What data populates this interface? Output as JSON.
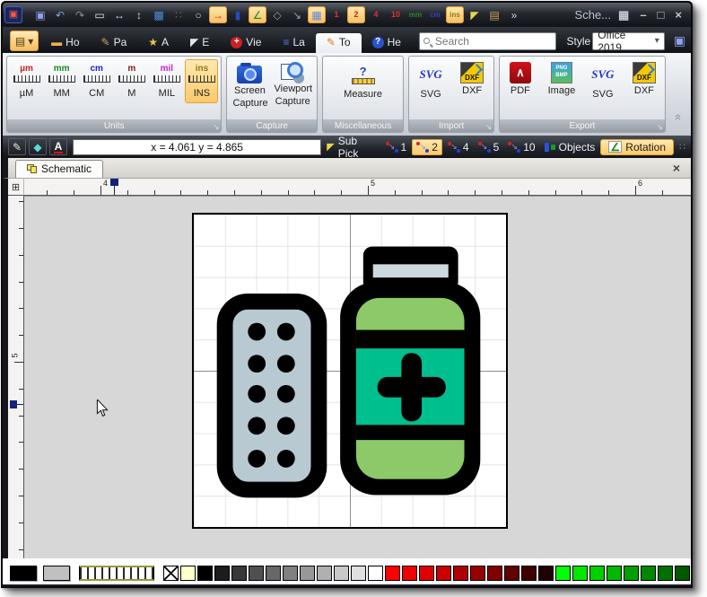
{
  "window": {
    "title": "Sche...",
    "controls": [
      {
        "name": "layout",
        "glyph": "▦"
      },
      {
        "name": "minimize",
        "glyph": "–"
      },
      {
        "name": "maximize",
        "glyph": "□"
      },
      {
        "name": "close",
        "glyph": "×"
      }
    ]
  },
  "titlebar": {
    "qat": [
      {
        "name": "app",
        "glyph": "▣",
        "color": "#ff5544",
        "hl": false
      },
      {
        "name": "save",
        "glyph": "▣",
        "color": "#8fa0ee",
        "hl": false
      },
      {
        "name": "undo",
        "glyph": "↶",
        "color": "#7aa0e0",
        "hl": false
      },
      {
        "name": "redo",
        "glyph": "↷",
        "color": "#8a9098",
        "hl": false
      },
      {
        "name": "rectangle",
        "glyph": "▭",
        "color": "#e8ecf2",
        "hl": false
      },
      {
        "name": "resize-width",
        "glyph": "↔",
        "color": "#cfd6e0",
        "hl": false
      },
      {
        "name": "resize-height",
        "glyph": "↕",
        "color": "#cfd6e0",
        "hl": false
      },
      {
        "name": "image",
        "glyph": "▩",
        "color": "#4a90d9",
        "hl": false
      },
      {
        "name": "pick-color",
        "glyph": "∷",
        "color": "#3a8a3a",
        "hl": false
      },
      {
        "name": "zoom",
        "glyph": "○",
        "color": "#d0d4da",
        "hl": false
      },
      {
        "name": "snap-point",
        "glyph": "→",
        "color": "#cc2222",
        "hl": true
      },
      {
        "name": "guides",
        "glyph": "▮",
        "color": "#2848c8",
        "hl": false
      },
      {
        "name": "chart",
        "glyph": "∠",
        "color": "#1a8a1a",
        "hl": true
      },
      {
        "name": "center-point",
        "glyph": "◇",
        "color": "#9aa0a8",
        "hl": false
      },
      {
        "name": "route",
        "glyph": "↘",
        "color": "#9aa0a8",
        "hl": false
      },
      {
        "name": "grid",
        "glyph": "▦",
        "color": "#6688dd",
        "hl": true
      },
      {
        "name": "snap-1",
        "glyph": "1",
        "color": "#dd3333",
        "hl": false
      },
      {
        "name": "snap-2",
        "glyph": "2",
        "color": "#cc2222",
        "hl": true
      },
      {
        "name": "snap-4",
        "glyph": "4",
        "color": "#dd3333",
        "hl": false
      },
      {
        "name": "snap-10",
        "glyph": "10",
        "color": "#dd3333",
        "hl": false
      },
      {
        "name": "unit-mm",
        "glyph": "mm",
        "color": "#2a8a2a",
        "hl": false
      },
      {
        "name": "unit-cm",
        "glyph": "cm",
        "color": "#3a3acc",
        "hl": false
      },
      {
        "name": "unit-ins",
        "glyph": "ins",
        "color": "#8a7a1a",
        "hl": true
      },
      {
        "name": "pointer",
        "glyph": "◤",
        "color": "#e8d44a",
        "hl": false
      },
      {
        "name": "properties",
        "glyph": "▤",
        "color": "#d0a858",
        "hl": false
      },
      {
        "name": "overflow",
        "glyph": "»",
        "color": "#cfd6e0",
        "hl": false
      }
    ]
  },
  "ribbon": {
    "menu": {
      "glyph": "▤",
      "caret": "▾"
    },
    "tabs": [
      {
        "id": "home",
        "label": "Ho",
        "glyph": "▬",
        "color": "#e8b64a"
      },
      {
        "id": "page",
        "label": "Pa",
        "glyph": "✎",
        "color": "#c8a060"
      },
      {
        "id": "arrange",
        "label": "A",
        "glyph": "★",
        "color": "#e8c84a"
      },
      {
        "id": "edit",
        "label": "E",
        "glyph": "◤",
        "color": "#e6e6ee"
      },
      {
        "id": "view",
        "label": "Vie",
        "glyph": "+",
        "color": "#ffffff",
        "bg": "#cc2222"
      },
      {
        "id": "layers",
        "label": "La",
        "glyph": "≡",
        "color": "#5a78e8"
      },
      {
        "id": "tools",
        "label": "To",
        "glyph": "✎",
        "color": "#e07820",
        "sel": true
      },
      {
        "id": "help",
        "label": "He",
        "glyph": "?",
        "color": "#ffffff",
        "bg": "#2a52cc"
      }
    ],
    "search": {
      "placeholder": "Search"
    },
    "style": {
      "label": "Style",
      "value": "Office 2019",
      "caret": "▾"
    },
    "save_glyph": "▣",
    "collapse_glyph": "«",
    "groups": {
      "launcher_glyph": "↘",
      "units": {
        "label": "Units",
        "buttons": [
          {
            "top": "µm",
            "color": "#cc2222",
            "caption": "µM"
          },
          {
            "top": "mm",
            "color": "#1a8a1a",
            "caption": "MM"
          },
          {
            "top": "cm",
            "color": "#2222cc",
            "caption": "CM"
          },
          {
            "top": "m",
            "color": "#8a1a1a",
            "caption": "M"
          },
          {
            "top": "mil",
            "color": "#cc22cc",
            "caption": "MIL"
          },
          {
            "top": "ins",
            "color": "#8a7a1a",
            "caption": "INS",
            "sel": true
          }
        ]
      },
      "capture": {
        "label": "Capture",
        "buttons": [
          {
            "label": "Screen\nCapture"
          },
          {
            "label": "Viewport\nCapture"
          }
        ]
      },
      "misc": {
        "label": "Miscellaneous",
        "buttons": [
          {
            "label": "Measure",
            "icon": "?"
          }
        ]
      },
      "import": {
        "label": "Import",
        "buttons": [
          {
            "label": "SVG",
            "icon": "SVG"
          },
          {
            "label": "DXF",
            "icon": "DXF"
          }
        ]
      },
      "export": {
        "label": "Export",
        "buttons": [
          {
            "label": "PDF",
            "icon": "∧"
          },
          {
            "label": "Image",
            "icon": "PNG\nBMP"
          },
          {
            "label": "SVG",
            "icon": "SVG"
          },
          {
            "label": "DXF",
            "icon": "DXF"
          }
        ]
      }
    }
  },
  "format_bar": {
    "tools": [
      {
        "name": "pen",
        "glyph": "✎",
        "color": "#e8e4d8"
      },
      {
        "name": "fill",
        "glyph": "◆",
        "color": "#5ad8d8"
      },
      {
        "name": "font-color",
        "glyph": "A",
        "color": "#ffffff",
        "underline": true
      }
    ],
    "coords": "x = 4.061 y = 4.865",
    "sub_pick_glyph": "◤",
    "sub_pick": "Sub Pick",
    "snap_glyph": "↘",
    "snaps": [
      {
        "label": "1"
      },
      {
        "label": "2",
        "sel": true
      },
      {
        "label": "4"
      },
      {
        "label": "5"
      },
      {
        "label": "10"
      }
    ],
    "objects": "Objects",
    "rotation_glyph": "∠",
    "rotation": "Rotation",
    "grip_glyph": "∷"
  },
  "doc_tabs": {
    "active": "Schematic",
    "close_glyph": "×"
  },
  "rulers": {
    "corner_glyph": "⊞",
    "h_labels": [
      "4",
      "5",
      "6"
    ],
    "v_labels": [
      "5"
    ]
  },
  "canvas": {
    "drawing": {
      "blister_fill": "#b9c9d1",
      "bottle_green": "#8cc968",
      "bottle_teal": "#00bf8e",
      "cap_band": "#ccd9de",
      "outline": "#000000"
    }
  },
  "palette": {
    "preview": [
      "#000000",
      "#c0c0c0"
    ],
    "swatches": [
      "none",
      "#ffffcc",
      "#000000",
      "#1c1c1c",
      "#383838",
      "#505050",
      "#686868",
      "#808080",
      "#989898",
      "#b0b0b0",
      "#c8c8c8",
      "#e0e0e0",
      "#ffffff",
      "#ff0000",
      "#f00000",
      "#e00000",
      "#c80000",
      "#b00000",
      "#980000",
      "#800000",
      "#600000",
      "#400000",
      "#200000",
      "#00ff00",
      "#00e800",
      "#00d000",
      "#00b800",
      "#00a000",
      "#008800",
      "#007000",
      "#005800",
      "#004000"
    ]
  }
}
